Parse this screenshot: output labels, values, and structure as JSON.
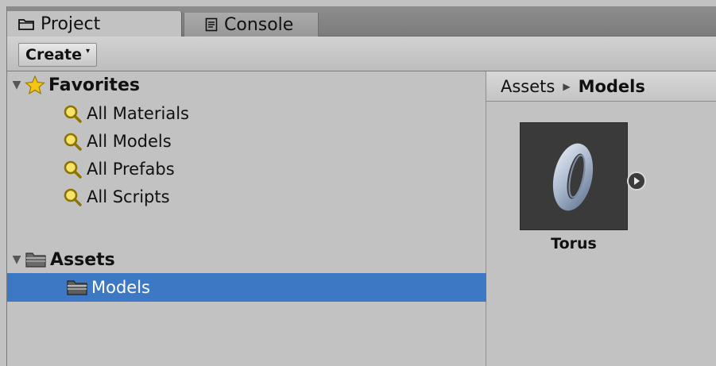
{
  "tabs": [
    {
      "label": "Project",
      "icon": "folder-icon",
      "active": true
    },
    {
      "label": "Console",
      "icon": "console-icon",
      "active": false
    }
  ],
  "toolbar": {
    "create_label": "Create",
    "create_caret": "▾"
  },
  "tree": {
    "favorites": {
      "label": "Favorites",
      "items": [
        "All Materials",
        "All Models",
        "All Prefabs",
        "All Scripts"
      ]
    },
    "assets": {
      "label": "Assets",
      "children": [
        "Models"
      ],
      "selected": "Models"
    }
  },
  "breadcrumb": {
    "root": "Assets",
    "separator": "▶",
    "current": "Models"
  },
  "assets": [
    {
      "label": "Torus",
      "icon": "torus-mesh-icon"
    }
  ],
  "colors": {
    "selection": "#3d78c4",
    "panel": "#c2c2c2",
    "tile_bg": "#3a3a3a"
  }
}
